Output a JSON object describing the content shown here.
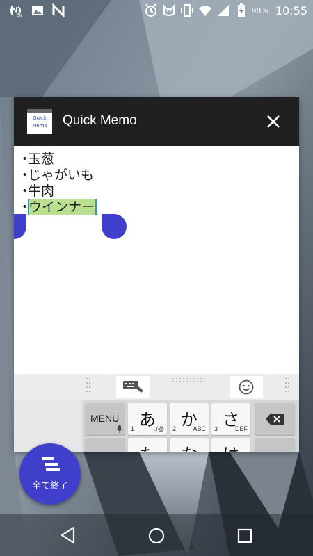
{
  "status_bar": {
    "left_icons": [
      "nfc-n-icon",
      "image-icon",
      "n-app-icon"
    ],
    "right_icons": [
      "alarm-icon",
      "cat-app-icon",
      "vibrate-icon",
      "wifi-icon",
      "signal-icon",
      "battery-charging-icon"
    ],
    "battery": "98%",
    "time": "10:55"
  },
  "memo_window": {
    "logo_top": "Quick",
    "logo_bottom": "Memo",
    "title": "Quick Memo",
    "close_icon": "close-icon",
    "bullet": "・",
    "lines": [
      "",
      "玉葱",
      "じゃがいも",
      "牛肉",
      "ウインナー"
    ],
    "selected_line_index": 4,
    "selection_color": "#b9e08e",
    "cursor_color": "#1e9ec8",
    "handle_color": "#3f3fcc"
  },
  "keyboard": {
    "toolbar_icons": [
      "keyboard-switch-icon",
      "emoji-icon"
    ],
    "menu_label": "MENU",
    "keys_row1": [
      {
        "kana": "あ",
        "num": "1",
        "sub": "./@"
      },
      {
        "kana": "か",
        "num": "2",
        "sub": "ABC"
      },
      {
        "kana": "さ",
        "num": "3",
        "sub": "DEF"
      }
    ],
    "keys_row2": [
      {
        "kana": "た"
      },
      {
        "kana": "な"
      },
      {
        "kana": "は"
      }
    ],
    "backspace_icon": "backspace-icon"
  },
  "end_all_button": {
    "label": "全て終了",
    "icon": "stack-clear-icon",
    "color": "#3f3fcc"
  },
  "nav_bar": {
    "icons": [
      "back-icon",
      "home-icon",
      "recents-icon"
    ]
  }
}
